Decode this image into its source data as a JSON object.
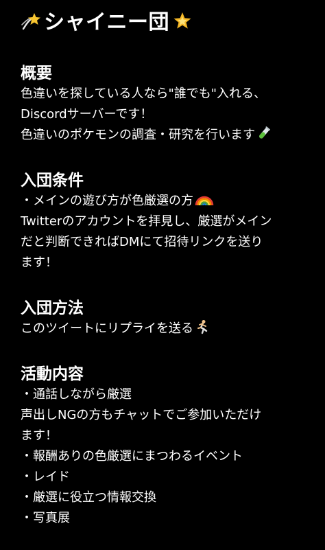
{
  "title": {
    "text": "シャイニー団",
    "left_icon": "dizzy-star-icon",
    "right_icon": "glowing-star-icon"
  },
  "sections": [
    {
      "heading": "概要",
      "lines": [
        "色違いを探している人なら\"誰でも\"入れる、",
        "Discordサーバーです！",
        "色違いのポケモンの調査・研究を行います"
      ],
      "line_icon": "test-tube-icon"
    },
    {
      "heading": "入団条件",
      "lines": [
        "・メインの遊び方が色厳選の方",
        "Twitterのアカウントを拝見し、厳選がメイン",
        "だと判断できればDMにて招待リンクを送り",
        "ます！"
      ],
      "line_icon": "rainbow-icon"
    },
    {
      "heading": "入団方法",
      "lines": [
        "このツイートにリプライを送る"
      ],
      "line_icon": "runner-icon"
    },
    {
      "heading": "活動内容",
      "lines": [
        "・通話しながら厳選",
        "声出しNGの方もチャットでご参加いただけ",
        "ます！",
        "・報酬ありの色厳選にまつわるイベント",
        "・レイド",
        "・厳選に役立つ情報交換",
        "・写真展"
      ]
    }
  ],
  "colors": {
    "background": "#000000",
    "text": "#ffffff"
  }
}
